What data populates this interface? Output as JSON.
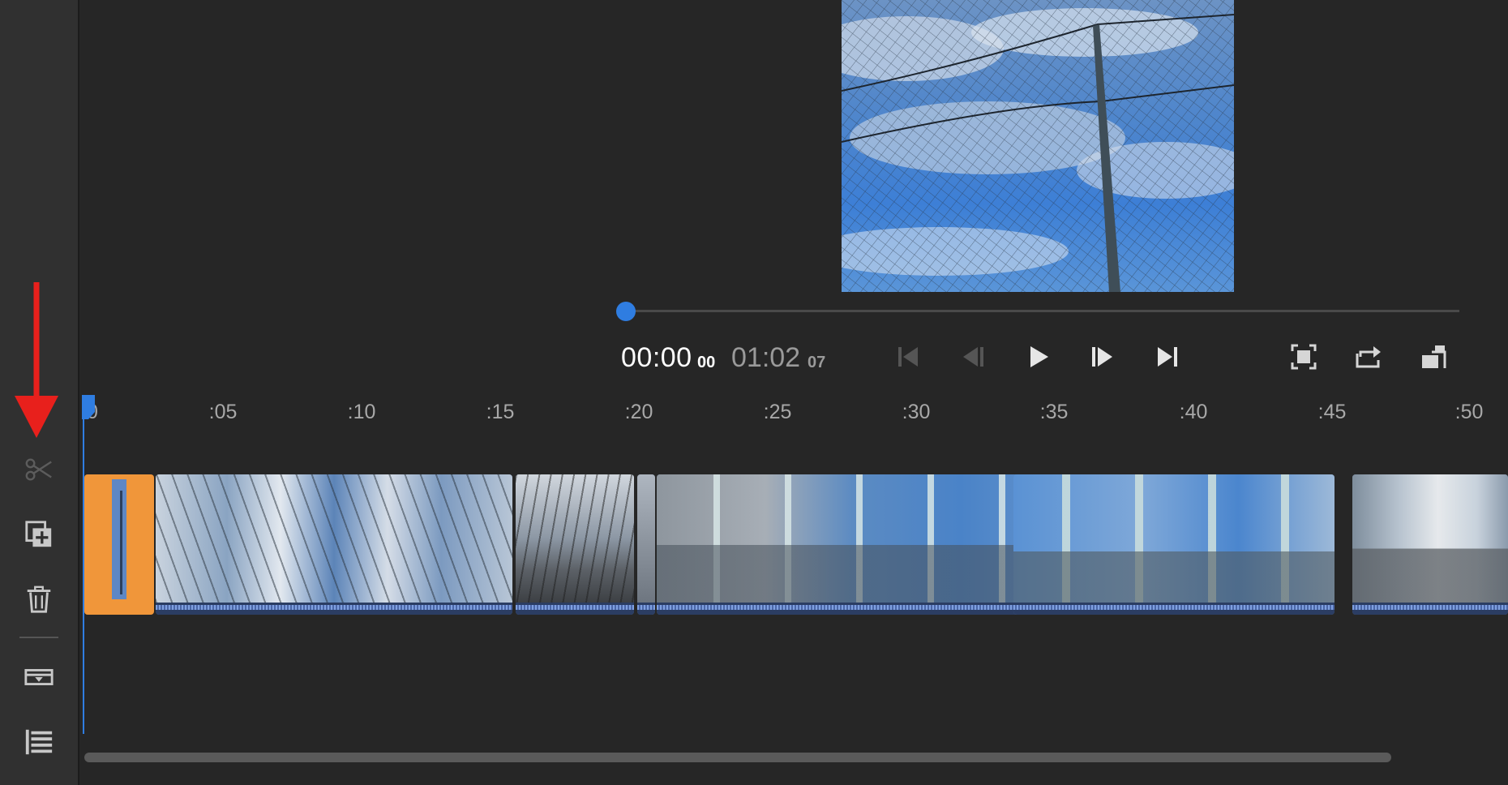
{
  "timecode": {
    "current": "00:00",
    "current_frames": "00",
    "total": "01:02",
    "total_frames": "07"
  },
  "ruler": {
    "ticks": [
      "0",
      ":05",
      ":10",
      ":15",
      ":20",
      ":25",
      ":30",
      ":35",
      ":40",
      ":45",
      ":50"
    ]
  },
  "toolbar": {
    "icons": [
      "scissors-icon",
      "add-clip-icon",
      "trash-icon",
      "track-options-icon",
      "list-view-icon"
    ]
  },
  "playback": {
    "buttons": [
      "go-to-start-icon",
      "step-back-icon",
      "play-icon",
      "step-forward-icon",
      "go-to-end-icon",
      "fit-to-screen-icon",
      "loop-icon",
      "resize-preview-icon"
    ]
  },
  "scrubber": {
    "position": 0
  },
  "colors": {
    "accent": "#2f7de1",
    "selected_clip": "#f0963a",
    "annotation_arrow": "#e8201c",
    "background": "#262626"
  }
}
